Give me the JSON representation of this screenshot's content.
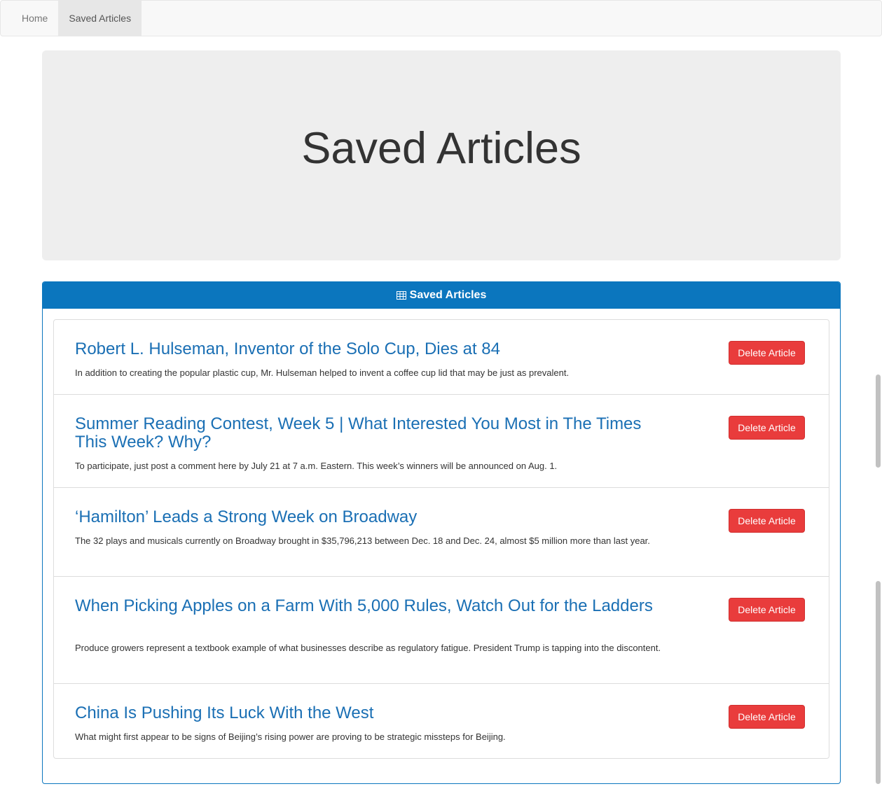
{
  "nav": {
    "items": [
      {
        "label": "Home"
      },
      {
        "label": "Saved Articles"
      }
    ]
  },
  "jumbotron": {
    "title": "Saved Articles"
  },
  "panel": {
    "heading": "Saved Articles",
    "heading_icon": "table-icon"
  },
  "articles": [
    {
      "title": "Robert L. Hulseman, Inventor of the Solo Cup, Dies at 84",
      "summary": "In addition to creating the popular plastic cup, Mr. Hulseman helped to invent a coffee cup lid that may be just as prevalent.",
      "button": "Delete Article"
    },
    {
      "title": "Summer Reading Contest, Week 5 | What Interested You Most in The Times This Week? Why?",
      "summary": "To participate, just post a comment here by July 21 at 7 a.m. Eastern. This week’s winners will be announced on Aug. 1.",
      "button": "Delete Article"
    },
    {
      "title": "‘Hamilton’ Leads a Strong Week on Broadway",
      "summary": "The 32 plays and musicals currently on Broadway brought in $35,796,213 between Dec. 18 and Dec. 24, almost $5 million more than last year.",
      "button": "Delete Article"
    },
    {
      "title": "When Picking Apples on a Farm With 5,000 Rules, Watch Out for the Ladders",
      "summary": "Produce growers represent a textbook example of what businesses describe as regulatory fatigue. President Trump is tapping into the discontent.",
      "button": "Delete Article"
    },
    {
      "title": "China Is Pushing Its Luck With the West",
      "summary": "What might first appear to be signs of Beijing’s rising power are proving to be strategic missteps for Beijing.",
      "button": "Delete Article"
    }
  ],
  "colors": {
    "primary": "#0b76be",
    "link": "#1a6fb4",
    "danger": "#e93c3c",
    "jumbotron_bg": "#eeeeee"
  }
}
